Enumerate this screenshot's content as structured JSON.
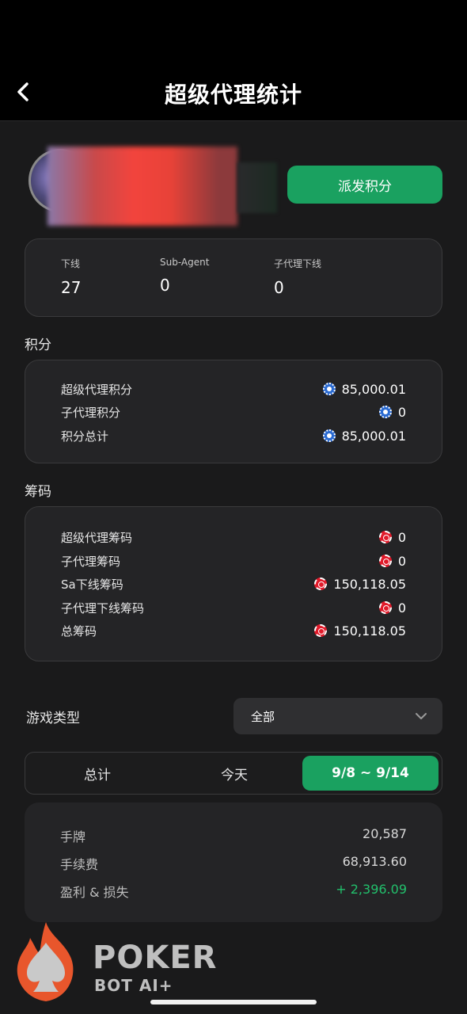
{
  "header": {
    "title": "超级代理统计"
  },
  "profile": {
    "dispatch_label": "派发积分"
  },
  "stats": [
    {
      "label": "下线",
      "value": "27"
    },
    {
      "label": "Sub-Agent",
      "value": "0"
    },
    {
      "label": "子代理下线",
      "value": "0"
    }
  ],
  "points": {
    "section_title": "积分",
    "rows": [
      {
        "label": "超级代理积分",
        "value": "85,000.01"
      },
      {
        "label": "子代理积分",
        "value": "0"
      },
      {
        "label": "积分总计",
        "value": "85,000.01"
      }
    ]
  },
  "chips": {
    "section_title": "筹码",
    "rows": [
      {
        "label": "超级代理筹码",
        "value": "0"
      },
      {
        "label": "子代理筹码",
        "value": "0"
      },
      {
        "label": "Sa下线筹码",
        "value": "150,118.05"
      },
      {
        "label": "子代理下线筹码",
        "value": "0"
      },
      {
        "label": "总筹码",
        "value": "150,118.05"
      }
    ]
  },
  "game_type": {
    "label": "游戏类型",
    "selected": "全部"
  },
  "tabs": [
    {
      "label": "总计"
    },
    {
      "label": "今天"
    },
    {
      "label": "9/8 ~ 9/14"
    }
  ],
  "summary": {
    "rows": [
      {
        "label": "手牌",
        "value": "20,587"
      },
      {
        "label": "手续费",
        "value": "68,913.60"
      },
      {
        "label": "盈利 & 损失",
        "value": "+ 2,396.09"
      }
    ]
  },
  "watermark": {
    "line1": "POKER",
    "line2": "BOT AI+"
  },
  "colors": {
    "accent": "#1aa160",
    "profit": "#22c06c",
    "chip": "#e01a2a",
    "coin": "#2a6ad1"
  }
}
